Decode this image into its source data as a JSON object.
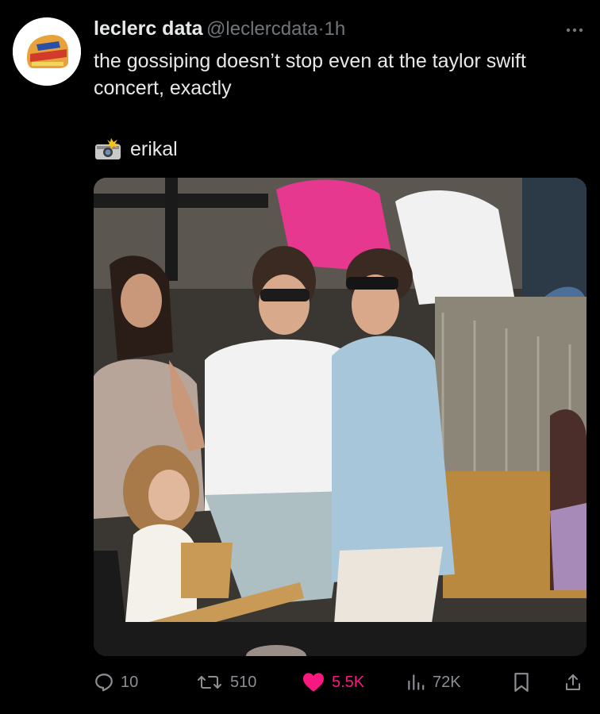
{
  "tweet": {
    "author_name": "leclerc data",
    "handle": "@leclercdata",
    "separator": "·",
    "time": "1h",
    "text": "the gossiping doesn’t stop even at the taylor swift concert, exactly",
    "photo_credit": "erikal",
    "photo_credit_icon": "camera-flash-emoji",
    "more_icon": "more-horizontal-icon"
  },
  "actions": {
    "replies": "10",
    "reposts": "510",
    "likes": "5.5K",
    "views": "72K",
    "like_color": "#f91880"
  },
  "theme": {
    "background": "#000000",
    "text_primary": "#e7e9ea",
    "text_secondary": "#71767b"
  }
}
